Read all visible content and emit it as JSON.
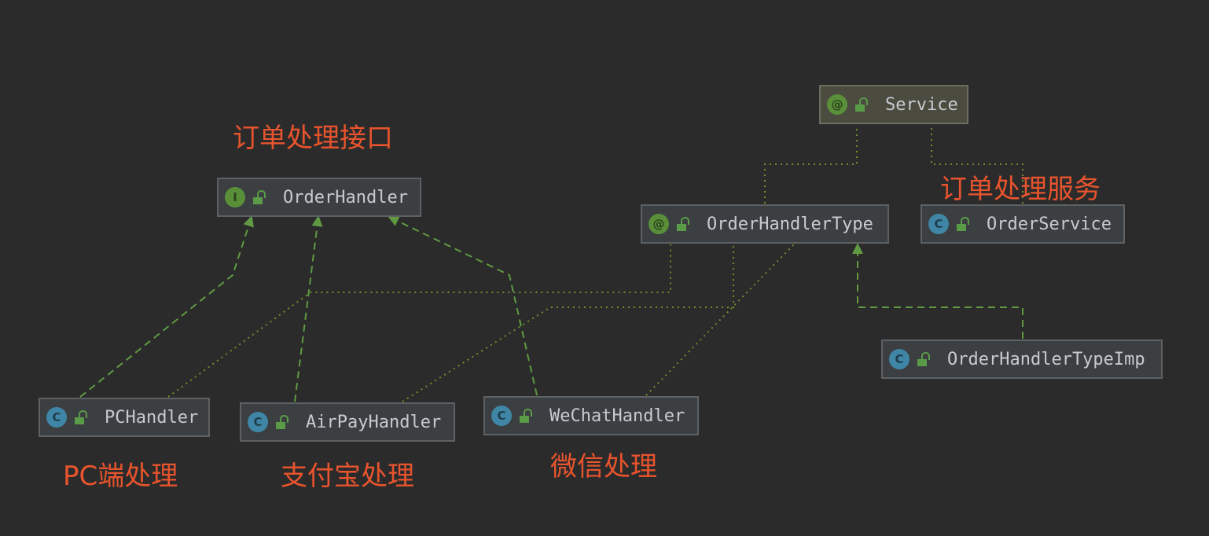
{
  "nodes": {
    "order_handler": {
      "label": "OrderHandler",
      "badge": "I"
    },
    "service": {
      "label": "Service",
      "badge": "@"
    },
    "order_handler_type": {
      "label": "OrderHandlerType",
      "badge": "@"
    },
    "order_service": {
      "label": "OrderService",
      "badge": "C"
    },
    "order_handler_type_imp": {
      "label": "OrderHandlerTypeImp",
      "badge": "C"
    },
    "pc_handler": {
      "label": "PCHandler",
      "badge": "C"
    },
    "airpay_handler": {
      "label": "AirPayHandler",
      "badge": "C"
    },
    "wechat_handler": {
      "label": "WeChatHandler",
      "badge": "C"
    }
  },
  "notes": {
    "order_interface": "订单处理接口",
    "order_service": "订单处理服务",
    "pc": "PC端处理",
    "alipay": "支付宝处理",
    "wechat": "微信处理"
  },
  "colors": {
    "background": "#2b2b2b",
    "node_fill": "#3c3f41",
    "annotation_fill": "#4b4b3f",
    "node_border": "#5e6164",
    "node_text": "#c7cbd1",
    "edge": "#5f9a43",
    "note_text": "#e8542d"
  }
}
